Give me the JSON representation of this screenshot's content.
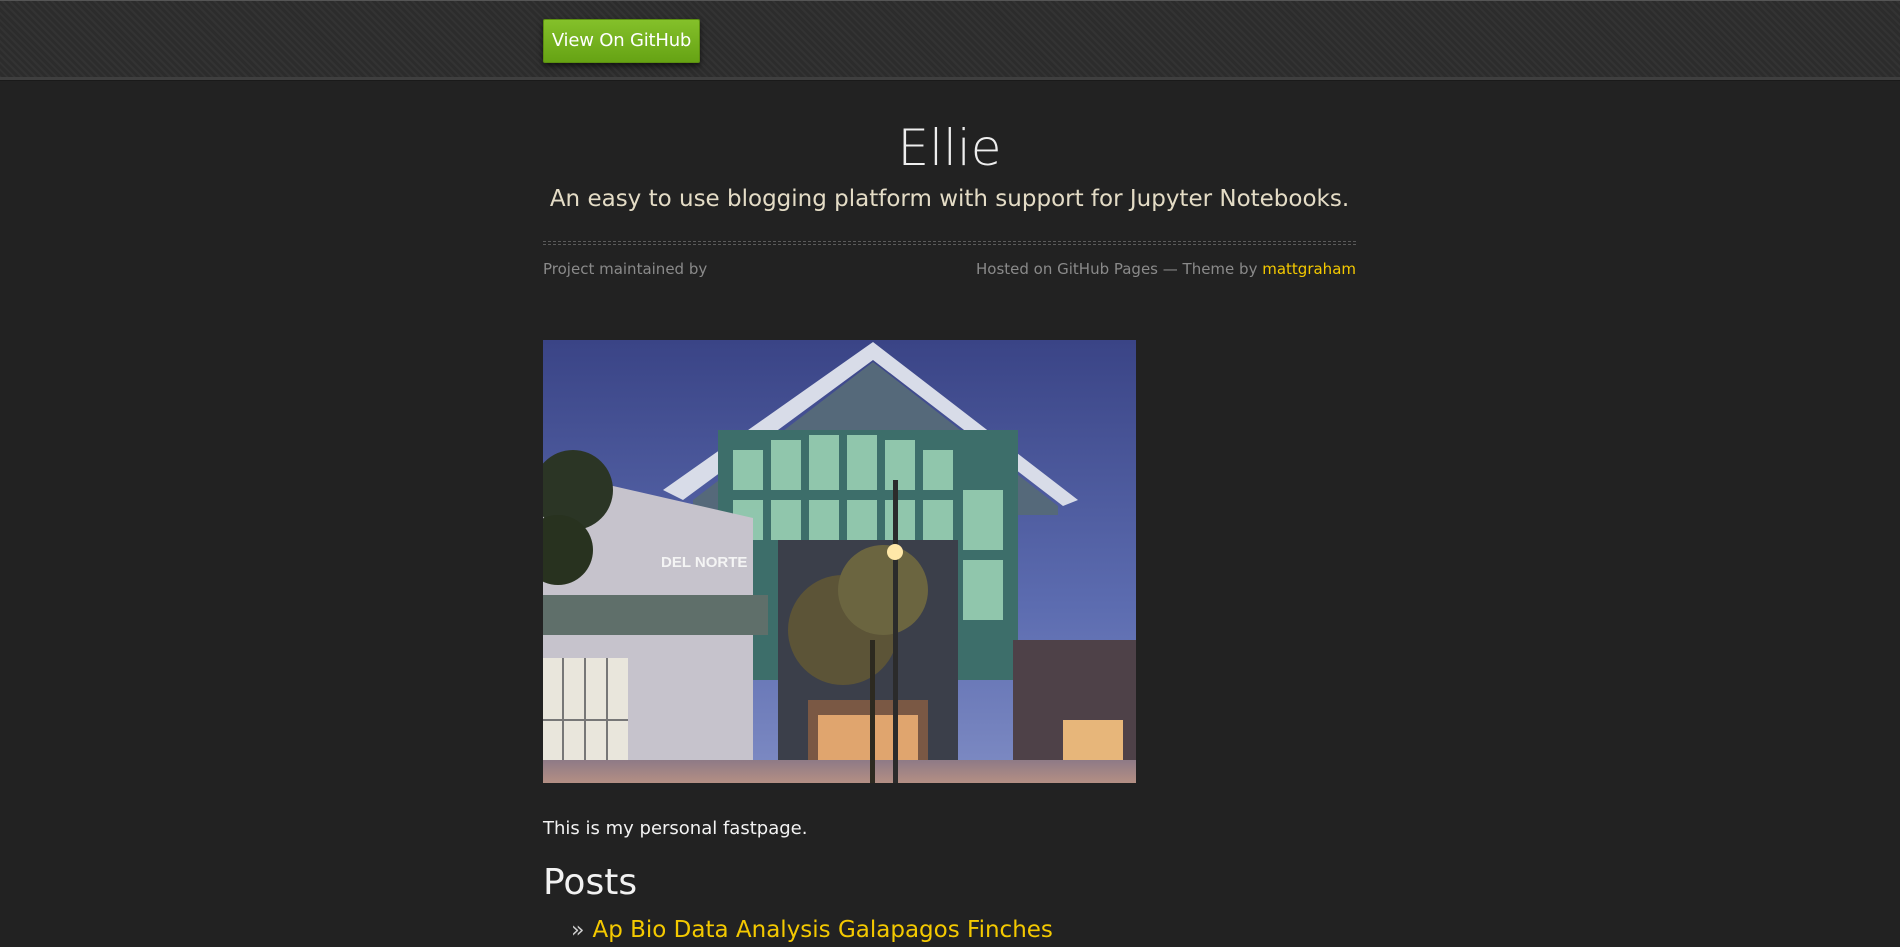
{
  "header": {
    "github_button_label": "View On GitHub"
  },
  "site": {
    "title": "Ellie",
    "tagline": "An easy to use blogging platform with support for Jupyter Notebooks."
  },
  "credits": {
    "maintained_by": "Project maintained by",
    "hosted_text": "Hosted on GitHub Pages — Theme by",
    "theme_author": "mattgraham"
  },
  "photo": {
    "sign_text": "DEL NORTE"
  },
  "content": {
    "intro": "This is my personal fastpage.",
    "posts_heading": "Posts",
    "posts": [
      {
        "bullet": "»",
        "title": "Ap Bio Data Analysis Galapagos Finches"
      }
    ]
  },
  "colors": {
    "background": "#222222",
    "accent_link": "#f4c900",
    "button_green": "#73b11f"
  }
}
